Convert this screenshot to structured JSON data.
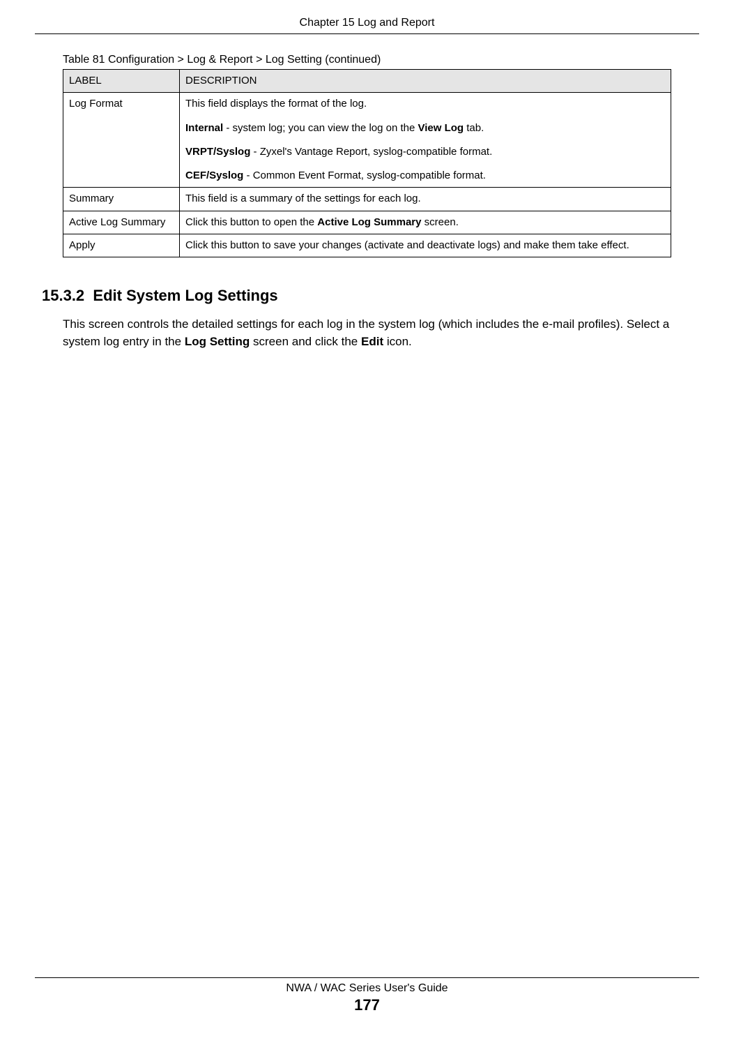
{
  "header": {
    "chapter": "Chapter 15 Log and Report"
  },
  "table": {
    "caption": "Table 81   Configuration > Log & Report > Log Setting (continued)",
    "head": {
      "label": "LABEL",
      "description": "DESCRIPTION"
    },
    "rows": [
      {
        "label": "Log Format",
        "desc": {
          "intro": "This field displays the format of the log.",
          "internal_b": "Internal",
          "internal_rest": " - system log; you can view the log on the ",
          "internal_viewlog_b": "View Log",
          "internal_tail": " tab.",
          "vrpt_b": "VRPT/Syslog",
          "vrpt_rest": " - Zyxel's Vantage Report, syslog-compatible format.",
          "cef_b": "CEF/Syslog",
          "cef_rest": " - Common Event Format, syslog-compatible format."
        }
      },
      {
        "label": "Summary",
        "desc": {
          "text": "This field is a summary of the settings for each log."
        }
      },
      {
        "label": "Active Log Summary",
        "desc": {
          "pre": "Click this button to open the ",
          "bold": "Active Log Summary",
          "post": " screen."
        }
      },
      {
        "label": "Apply",
        "desc": {
          "text": "Click this button to save your changes (activate and deactivate logs) and make them take effect."
        }
      }
    ]
  },
  "section": {
    "number": "15.3.2",
    "title": "Edit System Log Settings",
    "para_pre": "This screen controls the detailed settings for each log in the system log (which includes the e-mail profiles). Select a system log entry in the ",
    "para_b1": "Log Setting",
    "para_mid": " screen and click the ",
    "para_b2": "Edit",
    "para_post": " icon."
  },
  "footer": {
    "guide": "NWA / WAC Series User's Guide",
    "page": "177"
  }
}
